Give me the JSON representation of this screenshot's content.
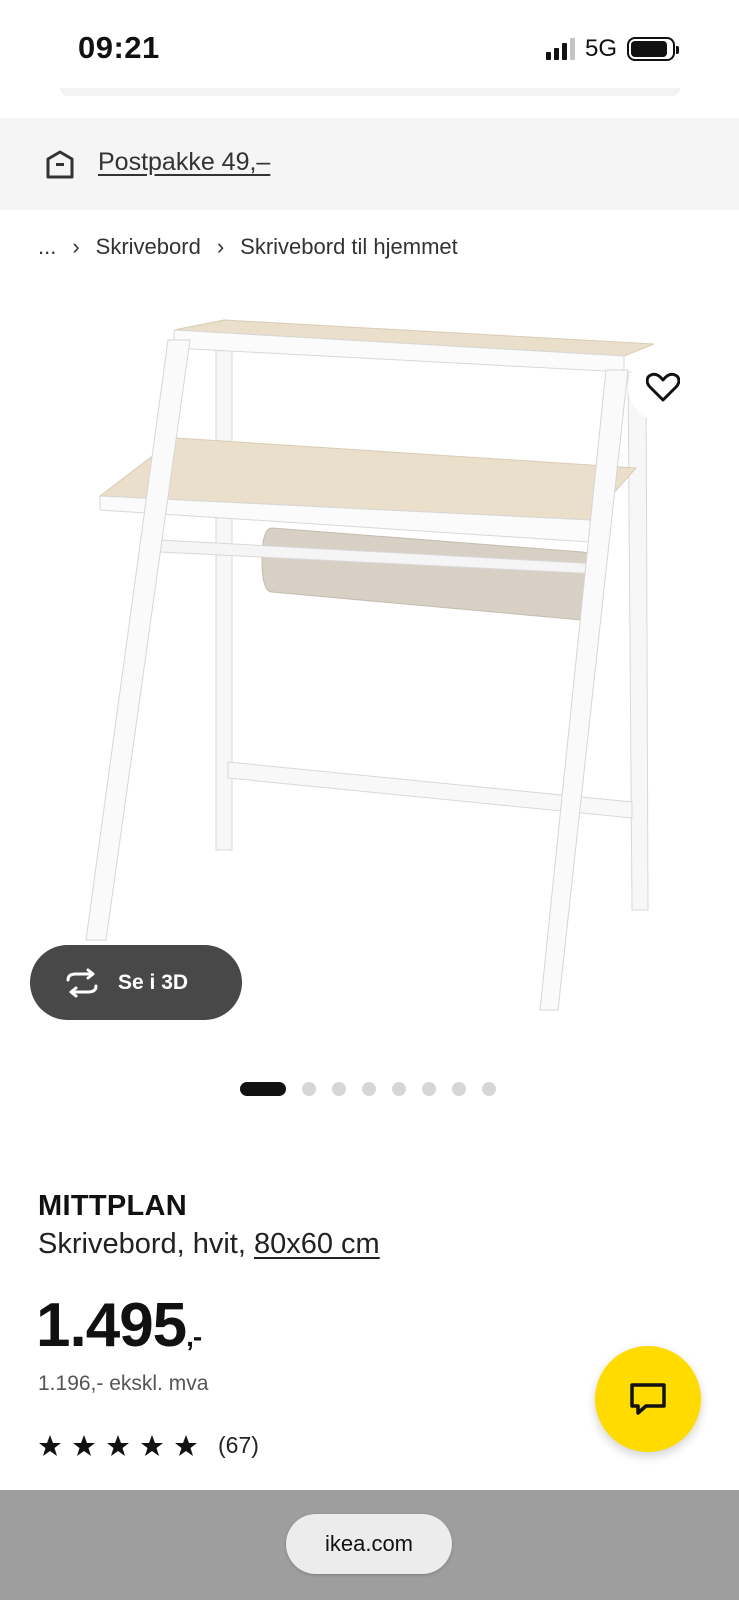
{
  "status_bar": {
    "time": "09:21",
    "network": "5G"
  },
  "delivery": {
    "icon": "box-icon",
    "link_text": "Postpakke 49,–"
  },
  "breadcrumb": {
    "ellipsis": "...",
    "separator": "›",
    "items": [
      "Skrivebord",
      "Skrivebord til hjemmet"
    ]
  },
  "gallery": {
    "favorite_icon": "heart-icon",
    "view_3d_label": "Se i 3D",
    "view_3d_icon": "rotate-icon",
    "image_count": 8,
    "active_index": 0
  },
  "product": {
    "name": "MITTPLAN",
    "description": "Skrivebord, hvit,",
    "size_link": "80x60 cm",
    "price": "1.495",
    "price_suffix": ",-",
    "price_ex_vat": "1.196,- ekskl. mva",
    "rating_stars": 5,
    "rating_count": "(67)"
  },
  "chat": {
    "icon": "chat-icon",
    "color": "#ffdb00"
  },
  "browser": {
    "url": "ikea.com"
  }
}
